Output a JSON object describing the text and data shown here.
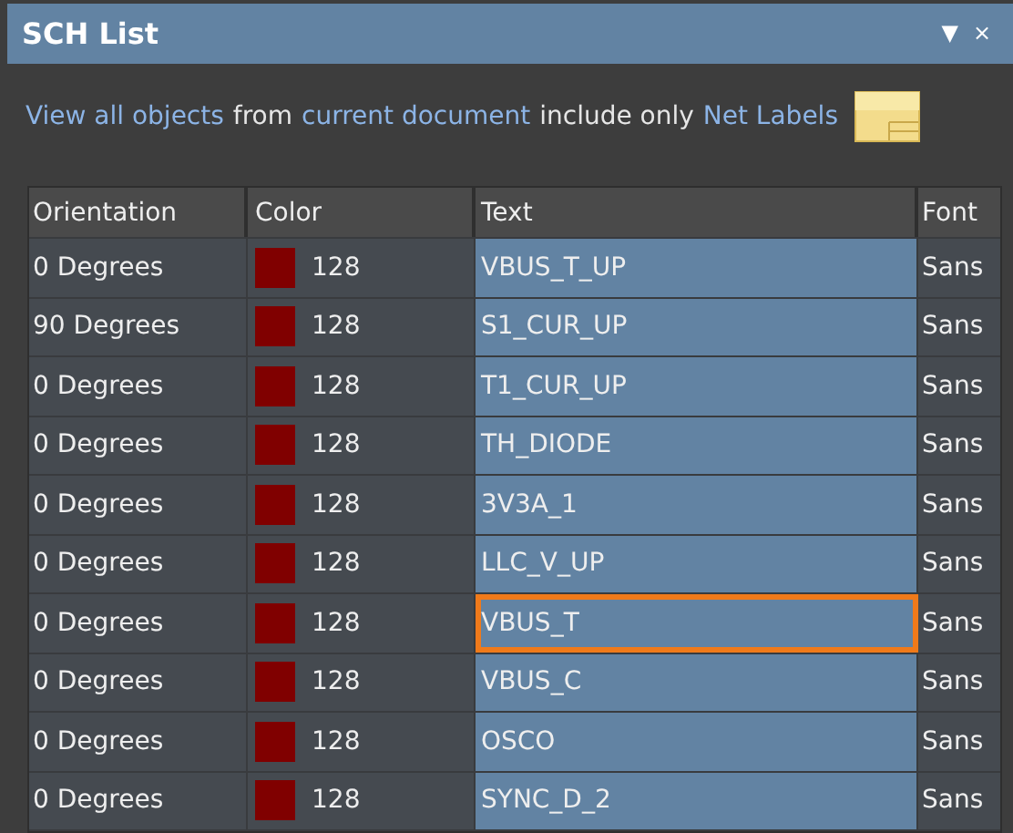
{
  "window": {
    "title": "SCH List",
    "menu_glyph": "▼",
    "close_glyph": "×"
  },
  "filter": [
    {
      "kind": "link",
      "text": "View all objects"
    },
    {
      "kind": "plain",
      "text": "from"
    },
    {
      "kind": "link",
      "text": "current document"
    },
    {
      "kind": "plain",
      "text": "include only"
    },
    {
      "kind": "link",
      "text": "Net Labels"
    }
  ],
  "table": {
    "columns": [
      "Orientation",
      "Color",
      "Text",
      "Font"
    ],
    "rows": [
      {
        "orientation": "0 Degrees",
        "color": "#800000",
        "color_value": "128",
        "text": "VBUS_T_UP",
        "font": "Sans",
        "selected": true,
        "focused": false
      },
      {
        "orientation": "90 Degrees",
        "color": "#800000",
        "color_value": "128",
        "text": "S1_CUR_UP",
        "font": "Sans",
        "selected": true,
        "focused": false
      },
      {
        "orientation": "0 Degrees",
        "color": "#800000",
        "color_value": "128",
        "text": "T1_CUR_UP",
        "font": "Sans",
        "selected": true,
        "focused": false
      },
      {
        "orientation": "0 Degrees",
        "color": "#800000",
        "color_value": "128",
        "text": "TH_DIODE",
        "font": "Sans",
        "selected": true,
        "focused": false
      },
      {
        "orientation": "0 Degrees",
        "color": "#800000",
        "color_value": "128",
        "text": "3V3A_1",
        "font": "Sans",
        "selected": true,
        "focused": false
      },
      {
        "orientation": "0 Degrees",
        "color": "#800000",
        "color_value": "128",
        "text": "LLC_V_UP",
        "font": "Sans",
        "selected": true,
        "focused": false
      },
      {
        "orientation": "0 Degrees",
        "color": "#800000",
        "color_value": "128",
        "text": "VBUS_T",
        "font": "Sans",
        "selected": true,
        "focused": true
      },
      {
        "orientation": "0 Degrees",
        "color": "#800000",
        "color_value": "128",
        "text": "VBUS_C",
        "font": "Sans",
        "selected": true,
        "focused": false
      },
      {
        "orientation": "0 Degrees",
        "color": "#800000",
        "color_value": "128",
        "text": "OSCO",
        "font": "Sans",
        "selected": true,
        "focused": false
      },
      {
        "orientation": "0 Degrees",
        "color": "#800000",
        "color_value": "128",
        "text": "SYNC_D_2",
        "font": "Sans",
        "selected": true,
        "focused": false
      }
    ]
  }
}
